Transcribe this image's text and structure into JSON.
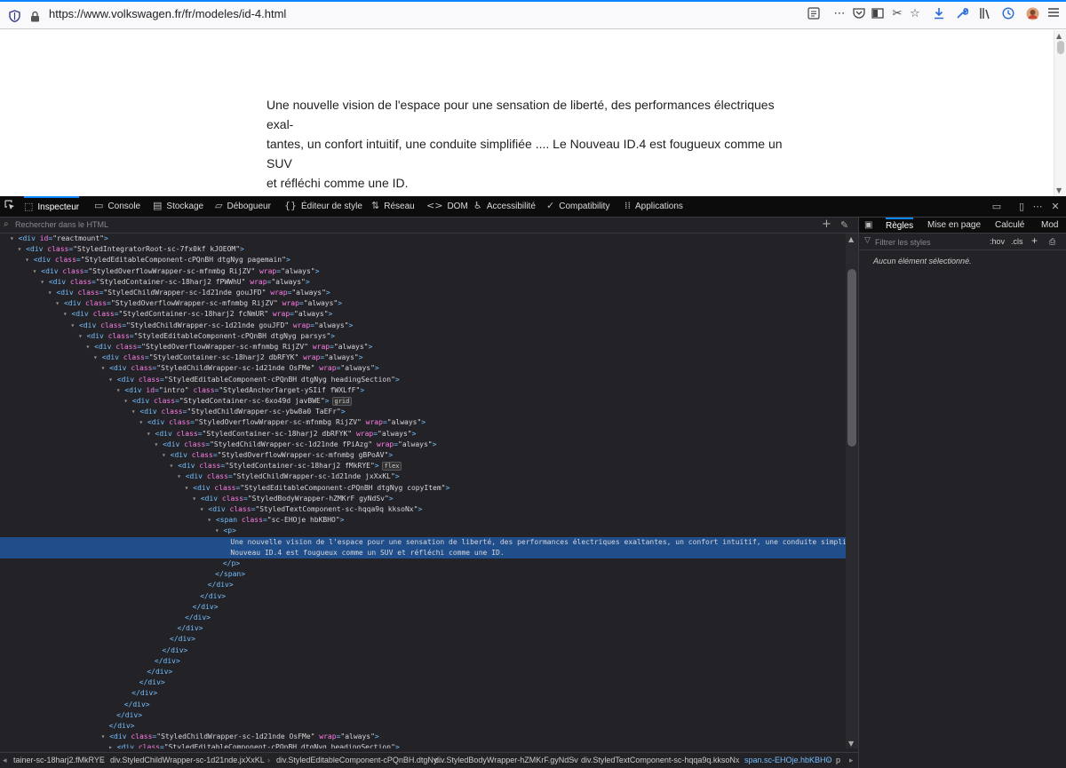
{
  "browser": {
    "url": "https://www.volkswagen.fr/fr/modeles/id-4.html",
    "icons": [
      "shield-icon",
      "lock-icon",
      "reader-view-icon",
      "more-icon",
      "pocket-icon",
      "reading-list-icon",
      "screenshot-icon",
      "bookmark-star-icon",
      "download-icon",
      "tools-icon",
      "library-icon",
      "history-icon",
      "avatar",
      "menu-icon"
    ]
  },
  "page": {
    "paragraph": "Une nouvelle vision de l'espace pour une sensation de liberté, des performances électriques exal-\ntantes, un confort intuitif, une conduite simplifiée .... Le Nouveau ID.4 est fougueux comme un SUV\net réfléchi comme une ID."
  },
  "devtools": {
    "tabs": [
      {
        "label": "Inspecteur",
        "icon": "inspector-icon"
      },
      {
        "label": "Console",
        "icon": "console-icon"
      },
      {
        "label": "Stockage",
        "icon": "storage-icon"
      },
      {
        "label": "Débogueur",
        "icon": "debugger-icon"
      },
      {
        "label": "Éditeur de style",
        "icon": "style-editor-icon"
      },
      {
        "label": "Réseau",
        "icon": "network-icon"
      },
      {
        "label": "DOM",
        "icon": "dom-icon"
      },
      {
        "label": "Accessibilité",
        "icon": "accessibility-icon"
      },
      {
        "label": "Compatibility",
        "icon": "compatibility-icon"
      },
      {
        "label": "Applications",
        "icon": "applications-icon"
      }
    ],
    "search_placeholder": "Rechercher dans le HTML",
    "side_tabs": [
      "Règles",
      "Mise en page",
      "Calculé",
      "Mod"
    ],
    "filter_placeholder": "Filtrer les styles",
    "hov_label": ":hov",
    "cls_label": ".cls",
    "empty_message": "Aucun élément sélectionné.",
    "breadcrumbs": [
      "tainer-sc-18harj2.fMkRYE",
      "div.StyledChildWrapper-sc-1d21nde.jxXxKL",
      "div.StyledEditableComponent-cPQnBH.dtgNy...",
      "div.StyledBodyWrapper-hZMKrF.gyNdSv",
      "div.StyledTextComponent-sc-hqqa9q.kksoNx",
      "span.sc-EHOje.hbKBHO",
      "p"
    ],
    "tree": [
      {
        "indent": 0,
        "tw": "▾",
        "tag": "div",
        "attrs": [
          [
            "id",
            "reactmount"
          ]
        ],
        "close": ">"
      },
      {
        "indent": 1,
        "tw": "▾",
        "tag": "div",
        "attrs": [
          [
            "class",
            "StyledIntegratorRoot-sc-7fx0kf kJOEOM"
          ]
        ],
        "close": ">"
      },
      {
        "indent": 2,
        "tw": "▾",
        "tag": "div",
        "attrs": [
          [
            "class",
            "StyledEditableComponent-cPQnBH dtgNyg pagemain"
          ]
        ],
        "close": ">"
      },
      {
        "indent": 3,
        "tw": "▾",
        "tag": "div",
        "attrs": [
          [
            "class",
            "StyledOverflowWrapper-sc-mfnmbg RijZV"
          ],
          [
            "wrap",
            "always"
          ]
        ],
        "close": ">"
      },
      {
        "indent": 4,
        "tw": "▾",
        "tag": "div",
        "attrs": [
          [
            "class",
            "StyledContainer-sc-18harj2 fPWWhU"
          ],
          [
            "wrap",
            "always"
          ]
        ],
        "close": ">"
      },
      {
        "indent": 5,
        "tw": "▾",
        "tag": "div",
        "attrs": [
          [
            "class",
            "StyledChildWrapper-sc-1d21nde gouJFD"
          ],
          [
            "wrap",
            "always"
          ]
        ],
        "close": ">"
      },
      {
        "indent": 6,
        "tw": "▾",
        "tag": "div",
        "attrs": [
          [
            "class",
            "StyledOverflowWrapper-sc-mfnmbg RijZV"
          ],
          [
            "wrap",
            "always"
          ]
        ],
        "close": ">"
      },
      {
        "indent": 7,
        "tw": "▾",
        "tag": "div",
        "attrs": [
          [
            "class",
            "StyledContainer-sc-18harj2 fcNmUR"
          ],
          [
            "wrap",
            "always"
          ]
        ],
        "close": ">"
      },
      {
        "indent": 8,
        "tw": "▾",
        "tag": "div",
        "attrs": [
          [
            "class",
            "StyledChildWrapper-sc-1d21nde gouJFD"
          ],
          [
            "wrap",
            "always"
          ]
        ],
        "close": ">"
      },
      {
        "indent": 9,
        "tw": "▾",
        "tag": "div",
        "attrs": [
          [
            "class",
            "StyledEditableComponent-cPQnBH dtgNyg parsys"
          ]
        ],
        "close": ">"
      },
      {
        "indent": 10,
        "tw": "▾",
        "tag": "div",
        "attrs": [
          [
            "class",
            "StyledOverflowWrapper-sc-mfnmbg RijZV"
          ],
          [
            "wrap",
            "always"
          ]
        ],
        "close": ">"
      },
      {
        "indent": 11,
        "tw": "▾",
        "tag": "div",
        "attrs": [
          [
            "class",
            "StyledContainer-sc-18harj2 dbRFYK"
          ],
          [
            "wrap",
            "always"
          ]
        ],
        "close": ">"
      },
      {
        "indent": 12,
        "tw": "▾",
        "tag": "div",
        "attrs": [
          [
            "class",
            "StyledChildWrapper-sc-1d21nde OsFMe"
          ],
          [
            "wrap",
            "always"
          ]
        ],
        "close": ">"
      },
      {
        "indent": 13,
        "tw": "▾",
        "tag": "div",
        "attrs": [
          [
            "class",
            "StyledEditableComponent-cPQnBH dtgNyg headingSection"
          ]
        ],
        "close": ">"
      },
      {
        "indent": 14,
        "tw": "▾",
        "tag": "div",
        "attrs": [
          [
            "id",
            "intro"
          ],
          [
            "class",
            "StyledAnchorTarget-ySIif fWXLfF"
          ]
        ],
        "close": ">"
      },
      {
        "indent": 15,
        "tw": "▾",
        "tag": "div",
        "attrs": [
          [
            "class",
            "StyledContainer-sc-6xo49d javBWE"
          ]
        ],
        "close": ">",
        "badge": "grid"
      },
      {
        "indent": 16,
        "tw": "▾",
        "tag": "div",
        "attrs": [
          [
            "class",
            "StyledChildWrapper-sc-ybw8a0 TaEFr"
          ]
        ],
        "close": ">"
      },
      {
        "indent": 17,
        "tw": "▾",
        "tag": "div",
        "attrs": [
          [
            "class",
            "StyledOverflowWrapper-sc-mfnmbg RijZV"
          ],
          [
            "wrap",
            "always"
          ]
        ],
        "close": ">"
      },
      {
        "indent": 18,
        "tw": "▾",
        "tag": "div",
        "attrs": [
          [
            "class",
            "StyledContainer-sc-18harj2 dbRFYK"
          ],
          [
            "wrap",
            "always"
          ]
        ],
        "close": ">"
      },
      {
        "indent": 19,
        "tw": "▾",
        "tag": "div",
        "attrs": [
          [
            "class",
            "StyledChildWrapper-sc-1d21nde fPiAzg"
          ],
          [
            "wrap",
            "always"
          ]
        ],
        "close": ">"
      },
      {
        "indent": 20,
        "tw": "▾",
        "tag": "div",
        "attrs": [
          [
            "class",
            "StyledOverflowWrapper-sc-mfnmbg gBPoAV"
          ]
        ],
        "close": ">"
      },
      {
        "indent": 21,
        "tw": "▾",
        "tag": "div",
        "attrs": [
          [
            "class",
            "StyledContainer-sc-18harj2 fMkRYE"
          ]
        ],
        "close": ">",
        "badge": "flex"
      },
      {
        "indent": 22,
        "tw": "▾",
        "tag": "div",
        "attrs": [
          [
            "class",
            "StyledChildWrapper-sc-1d21nde jxXxKL"
          ]
        ],
        "close": ">"
      },
      {
        "indent": 23,
        "tw": "▾",
        "tag": "div",
        "attrs": [
          [
            "class",
            "StyledEditableComponent-cPQnBH dtgNyg copyItem"
          ]
        ],
        "close": ">"
      },
      {
        "indent": 24,
        "tw": "▾",
        "tag": "div",
        "attrs": [
          [
            "class",
            "StyledBodyWrapper-hZMKrF gyNdSv"
          ]
        ],
        "close": ">"
      },
      {
        "indent": 25,
        "tw": "▾",
        "tag": "div",
        "attrs": [
          [
            "class",
            "StyledTextComponent-sc-hqqa9q kksoNx"
          ]
        ],
        "close": ">"
      },
      {
        "indent": 26,
        "tw": "▾",
        "tag": "span",
        "attrs": [
          [
            "class",
            "sc-EHOje hbKBHO"
          ]
        ],
        "close": ">"
      },
      {
        "indent": 27,
        "tw": "▾",
        "tag": "p",
        "attrs": [],
        "close": ">"
      },
      {
        "indent": 28,
        "text": "Une nouvelle vision de l'espace pour une sensation de liberté, des performances électriques exaltantes, un confort intuitif, une conduite simplifiée …. Le",
        "sel": true
      },
      {
        "indent": 28,
        "text": "Nouveau ID.4 est fougueux comme un SUV et réfléchi comme une ID.",
        "sel": true
      },
      {
        "indent": 27,
        "endtag": "p"
      },
      {
        "indent": 26,
        "endtag": "span"
      },
      {
        "indent": 25,
        "endtag": "div"
      },
      {
        "indent": 24,
        "endtag": "div"
      },
      {
        "indent": 23,
        "endtag": "div"
      },
      {
        "indent": 22,
        "endtag": "div"
      },
      {
        "indent": 21,
        "endtag": "div"
      },
      {
        "indent": 20,
        "endtag": "div"
      },
      {
        "indent": 19,
        "endtag": "div"
      },
      {
        "indent": 18,
        "endtag": "div"
      },
      {
        "indent": 17,
        "endtag": "div"
      },
      {
        "indent": 16,
        "endtag": "div"
      },
      {
        "indent": 15,
        "endtag": "div"
      },
      {
        "indent": 14,
        "endtag": "div"
      },
      {
        "indent": 13,
        "endtag": "div"
      },
      {
        "indent": 12,
        "endtag": "div"
      },
      {
        "indent": 12,
        "tw": "▾",
        "tag": "div",
        "attrs": [
          [
            "class",
            "StyledChildWrapper-sc-1d21nde OsFMe"
          ],
          [
            "wrap",
            "always"
          ]
        ],
        "close": ">"
      },
      {
        "indent": 13,
        "tw": "▸",
        "tag": "div",
        "attrs": [
          [
            "class",
            "StyledEditableComponent-cPQnBH dtgNyg headingSection"
          ]
        ],
        "close": ">"
      }
    ]
  }
}
